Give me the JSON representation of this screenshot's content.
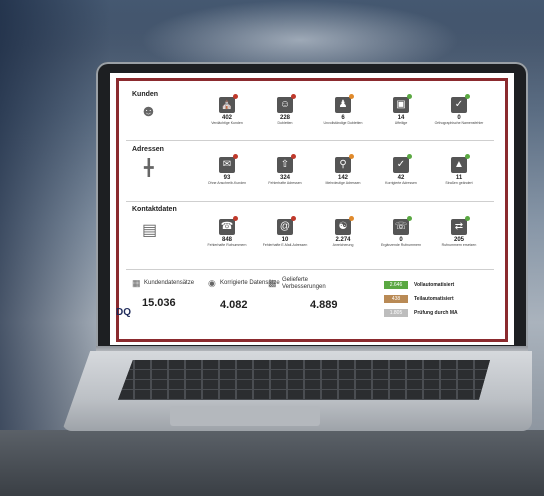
{
  "sections": {
    "kunden": "Kunden",
    "adressen": "Adressen",
    "kontaktdaten": "Kontaktdaten"
  },
  "kunden_tiles": [
    {
      "value": "402",
      "label": "Verdächtige Kunden",
      "icon": "building-icon",
      "status": "red"
    },
    {
      "value": "228",
      "label": "Dubletten",
      "icon": "person-card-icon",
      "status": "red"
    },
    {
      "value": "6",
      "label": "Unvollständige Dubletten",
      "icon": "group-icon",
      "status": "orange"
    },
    {
      "value": "14",
      "label": "Uffeilige",
      "icon": "window-icon",
      "status": "green"
    },
    {
      "value": "0",
      "label": "Orthographische Namensfehler",
      "icon": "abc-check-icon",
      "status": "green"
    }
  ],
  "adressen_tiles": [
    {
      "value": "93",
      "label": "Ohne Anschreib-Kunden",
      "icon": "envelope-icon",
      "status": "red"
    },
    {
      "value": "324",
      "label": "Fehlerhafte Adressen",
      "icon": "house-up-icon",
      "status": "red"
    },
    {
      "value": "142",
      "label": "Mehrdeutige Adressen",
      "icon": "house-search-icon",
      "status": "orange"
    },
    {
      "value": "42",
      "label": "Korrigierte Adressen",
      "icon": "house-check-icon",
      "status": "green"
    },
    {
      "value": "11",
      "label": "Straßen geändert",
      "icon": "road-icon",
      "status": "green"
    }
  ],
  "kontakt_tiles": [
    {
      "value": "848",
      "label": "Fehlerhafte Rufnummern",
      "icon": "phone-person-icon",
      "status": "red"
    },
    {
      "value": "10",
      "label": "Fehlerhafte E-Mail-Adressen",
      "icon": "at-icon",
      "status": "red"
    },
    {
      "value": "2.274",
      "label": "Anreicherung",
      "icon": "people-icon",
      "status": "orange"
    },
    {
      "value": "0",
      "label": "Ergänzende Rufnummern",
      "icon": "phone-check-icon",
      "status": "green"
    },
    {
      "value": "205",
      "label": "Rufnummern ersetzen",
      "icon": "phone-swap-icon",
      "status": "green"
    }
  ],
  "stats": {
    "kundendatensaetze_label": "Kundendatensätze",
    "kundendatensaetze_value": "15.036",
    "korrigierte_label": "Korrigierte Datensätze",
    "korrigierte_value": "4.082",
    "gelieferte_label": "Gelieferte Verbesserungen",
    "gelieferte_value": "4.889"
  },
  "legend": [
    {
      "value": "2.646",
      "label": "Vollautomatisiert",
      "color": "#5aa842"
    },
    {
      "value": "438",
      "label": "Teilautomatisiert",
      "color": "#b98a55"
    },
    {
      "value": "1.805",
      "label": "Prüfung durch MA",
      "color": "#bdbdbd"
    }
  ],
  "logo": "DQ"
}
